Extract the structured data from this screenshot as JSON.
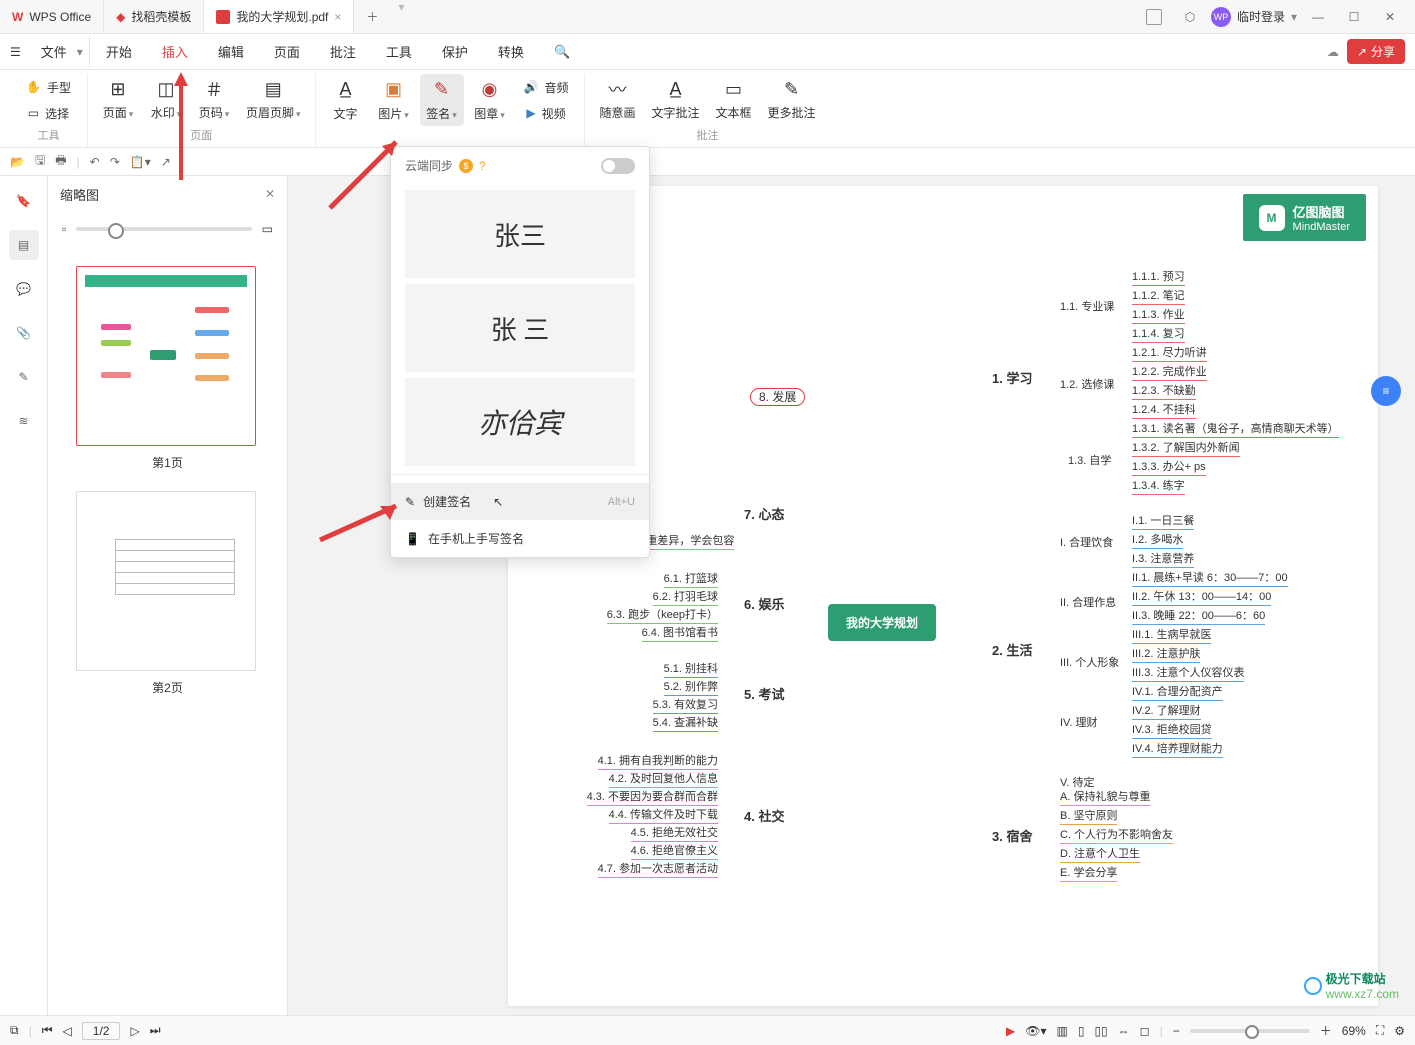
{
  "titlebar": {
    "tabs": [
      {
        "label": "WPS Office"
      },
      {
        "label": "找稻壳模板"
      },
      {
        "label": "我的大学规划.pdf"
      }
    ],
    "login": "临时登录"
  },
  "menubar": {
    "file": "文件",
    "items": [
      "开始",
      "插入",
      "编辑",
      "页面",
      "批注",
      "工具",
      "保护",
      "转换"
    ],
    "active": "插入",
    "share": "分享"
  },
  "ribbon": {
    "grp_tools": "工具",
    "hand": "手型",
    "select": "选择",
    "grp_page": "页面",
    "page": "页面",
    "watermark": "水印",
    "pagenum": "页码",
    "headerfooter": "页眉页脚",
    "text": "文字",
    "image": "图片",
    "signature": "签名",
    "stamp": "图章",
    "audio": "音频",
    "video": "视频",
    "freehand": "随意画",
    "textannot": "文字批注",
    "textbox": "文本框",
    "moreannot": "更多批注",
    "grp_annot": "批注"
  },
  "thumbs": {
    "title": "缩略图",
    "p1": "第1页",
    "p2": "第2页"
  },
  "sigdd": {
    "sync": "云端同步",
    "sig1": "张三",
    "sig2": "张 三",
    "sig3": "亦佮宾",
    "create": "创建签名",
    "create_kbd": "Alt+U",
    "mobile": "在手机上手写签名"
  },
  "doc": {
    "brand_l1": "亿图脑图",
    "brand_l2": "MindMaster",
    "center": "我的大学规划",
    "dev": "8. 发展",
    "study": {
      "lbl": "1. 学习",
      "s1": "1.1. 专业课",
      "s2": "1.2. 选修课",
      "s3": "1.3. 自学",
      "l": [
        "1.1.1. 预习",
        "1.1.2. 笔记",
        "1.1.3. 作业",
        "1.1.4. 复习",
        "1.2.1. 尽力听讲",
        "1.2.2. 完成作业",
        "1.2.3. 不缺勤",
        "1.2.4. 不挂科",
        "1.3.1. 读名著（鬼谷子，高情商聊天术等）",
        "1.3.2. 了解国内外新闻",
        "1.3.3. 办公+ ps",
        "1.3.4. 练字"
      ]
    },
    "life": {
      "lbl": "2. 生活",
      "s": [
        "I. 合理饮食",
        "II. 合理作息",
        "III. 个人形象",
        "IV. 理财",
        "V. 待定"
      ],
      "l": [
        "I.1. 一日三餐",
        "I.2. 多喝水",
        "I.3. 注意营养",
        "II.1. 晨练+早读 6：30——7：00",
        "II.2. 午休 13：00——14：00",
        "II.3. 晚睡 22：00——6：60",
        "III.1. 生病早就医",
        "III.2. 注意护肤",
        "III.3. 注意个人仪容仪表",
        "IV.1. 合理分配资产",
        "IV.2. 了解理财",
        "IV.3. 拒绝校园贷",
        "IV.4. 培养理财能力"
      ]
    },
    "dorm": {
      "lbl": "3. 宿舍",
      "l": [
        "A. 保持礼貌与尊重",
        "B. 坚守原则",
        "C. 个人行为不影响舍友",
        "D. 注意个人卫生",
        "E. 学会分享"
      ]
    },
    "social": {
      "lbl": "4. 社交",
      "l": [
        "4.1. 拥有自我判断的能力",
        "4.2. 及时回复他人信息",
        "4.3. 不要因为要合群而合群",
        "4.4. 传输文件及时下载",
        "4.5. 拒绝无效社交",
        "4.6. 拒绝官僚主义",
        "4.7. 参加一次志愿者活动"
      ]
    },
    "exam": {
      "lbl": "5. 考试",
      "l": [
        "5.1. 别挂科",
        "5.2. 别作弊",
        "5.3. 有效复习",
        "5.4. 查漏补缺"
      ]
    },
    "fun": {
      "lbl": "6. 娱乐",
      "l": [
        "6.1. 打篮球",
        "6.2. 打羽毛球",
        "6.3. 跑步（keep打卡）",
        "6.4. 图书馆看书"
      ]
    },
    "mind": {
      "lbl": "7. 心态",
      "l": [
        "7.4. 尊重差异，学会包容"
      ]
    }
  },
  "status": {
    "page_current": "1",
    "page_total": "2",
    "page_sep": "/",
    "zoom": "69%"
  },
  "watermark": {
    "txt": "极光下载站",
    "url": "www.xz7.com"
  }
}
